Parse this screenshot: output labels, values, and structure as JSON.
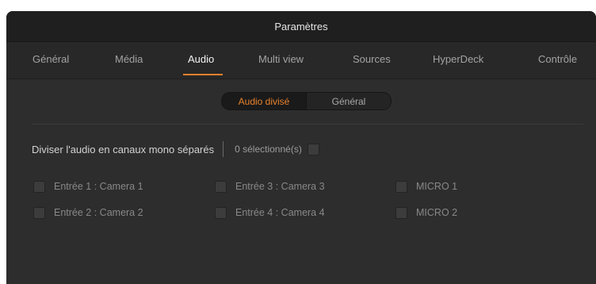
{
  "window": {
    "title": "Paramètres"
  },
  "tabs": [
    {
      "label": "Général",
      "active": false
    },
    {
      "label": "Média",
      "active": false
    },
    {
      "label": "Audio",
      "active": true
    },
    {
      "label": "Multi view",
      "active": false
    },
    {
      "label": "Sources",
      "active": false
    },
    {
      "label": "HyperDeck",
      "active": false
    },
    {
      "label": "Contrôle",
      "active": false
    }
  ],
  "segment": {
    "options": [
      {
        "label": "Audio divisé",
        "selected": true
      },
      {
        "label": "Général",
        "selected": false
      }
    ]
  },
  "split": {
    "label": "Diviser l'audio en canaux mono séparés",
    "count_text": "0 sélectionné(s)",
    "select_all_checked": false
  },
  "channels": [
    {
      "label": "Entrée 1 : Camera 1",
      "checked": false
    },
    {
      "label": "Entrée 3 : Camera 3",
      "checked": false
    },
    {
      "label": "MICRO 1",
      "checked": false
    },
    {
      "label": "Entrée 2 : Camera 2",
      "checked": false
    },
    {
      "label": "Entrée 4 : Camera 4",
      "checked": false
    },
    {
      "label": "MICRO 2",
      "checked": false
    }
  ],
  "colors": {
    "accent": "#e8812c",
    "background": "#2d2d2d",
    "titlebar": "#1f1f1f"
  }
}
